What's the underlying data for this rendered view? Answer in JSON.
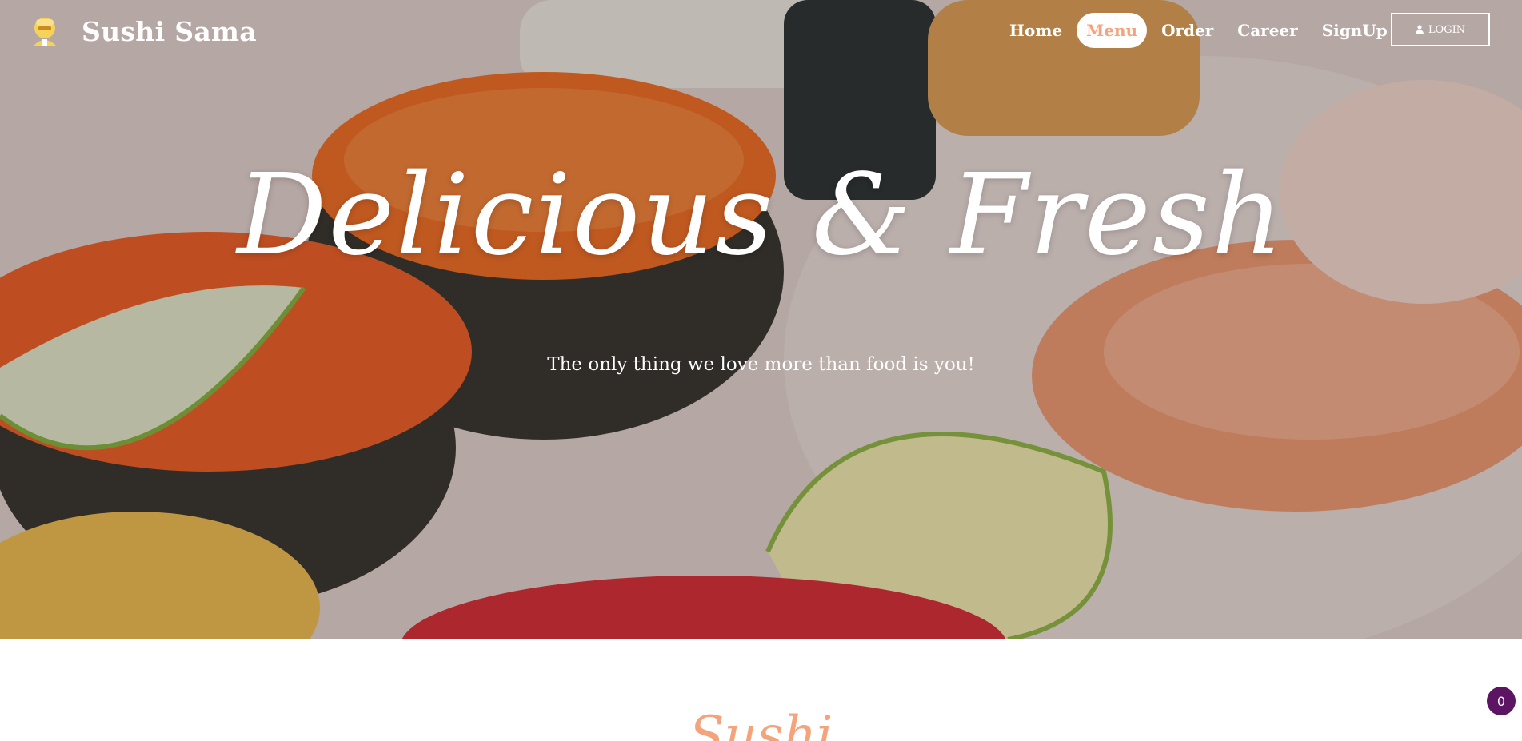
{
  "brand": {
    "name": "Sushi Sama",
    "logo_icon": "sushi-chef-icon"
  },
  "nav": {
    "links": [
      {
        "label": "Home",
        "active": false
      },
      {
        "label": "Menu",
        "active": true
      },
      {
        "label": "Order",
        "active": false
      },
      {
        "label": "Career",
        "active": false
      },
      {
        "label": "SignUp",
        "active": false
      }
    ],
    "login_label": "LOGIN",
    "login_icon": "user-icon"
  },
  "hero": {
    "title": "Delicious &  Fresh",
    "subtitle": "The only thing we love more than food is you!"
  },
  "section": {
    "heading": "Sushi"
  },
  "cart": {
    "count": "0"
  },
  "colors": {
    "accent": "#f4a47d",
    "badge": "#5c1563",
    "text_on_hero": "#ffffff"
  }
}
